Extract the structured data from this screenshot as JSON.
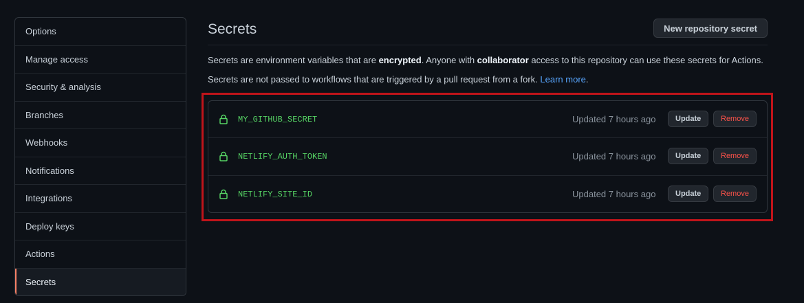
{
  "sidebar": {
    "items": [
      {
        "label": "Options"
      },
      {
        "label": "Manage access"
      },
      {
        "label": "Security & analysis"
      },
      {
        "label": "Branches"
      },
      {
        "label": "Webhooks"
      },
      {
        "label": "Notifications"
      },
      {
        "label": "Integrations"
      },
      {
        "label": "Deploy keys"
      },
      {
        "label": "Actions"
      },
      {
        "label": "Secrets",
        "active": true
      }
    ]
  },
  "header": {
    "title": "Secrets",
    "new_secret_label": "New repository secret"
  },
  "description": {
    "line1_part1": "Secrets are environment variables that are ",
    "line1_bold1": "encrypted",
    "line1_part2": ". Anyone with ",
    "line1_bold2": "collaborator",
    "line1_part3": " access to this repository can use these secrets for Actions.",
    "line2_text": "Secrets are not passed to workflows that are triggered by a pull request from a fork. ",
    "line2_link": "Learn more",
    "line2_end": "."
  },
  "secrets": [
    {
      "name": "MY_GITHUB_SECRET",
      "updated": "Updated 7 hours ago",
      "update_label": "Update",
      "remove_label": "Remove"
    },
    {
      "name": "NETLIFY_AUTH_TOKEN",
      "updated": "Updated 7 hours ago",
      "update_label": "Update",
      "remove_label": "Remove"
    },
    {
      "name": "NETLIFY_SITE_ID",
      "updated": "Updated 7 hours ago",
      "update_label": "Update",
      "remove_label": "Remove"
    }
  ],
  "colors": {
    "background": "#0d1117",
    "secret_name": "#56d364",
    "remove": "#f85149",
    "link": "#58a6ff",
    "highlight": "#c0141a",
    "active_indicator": "#f78166"
  },
  "icons": {
    "secret_row": "lock-icon"
  }
}
